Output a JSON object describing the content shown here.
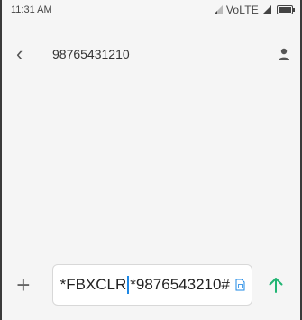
{
  "status_bar": {
    "time": "11:31 AM",
    "network": "VoLTE",
    "battery_level": 0.85
  },
  "header": {
    "back_icon": "chevron-left-icon",
    "title": "98765431210",
    "contact_icon": "person-icon"
  },
  "compose": {
    "attach_icon": "plus-icon",
    "text_before_cursor": "*FBXCLR",
    "text_after_cursor": "*9876543210#",
    "sim_icon": "sim-card-icon",
    "send_icon": "send-arrow-icon"
  },
  "colors": {
    "accent": "#1e88e5",
    "send": "#21b573",
    "background": "#f5f5f5"
  }
}
